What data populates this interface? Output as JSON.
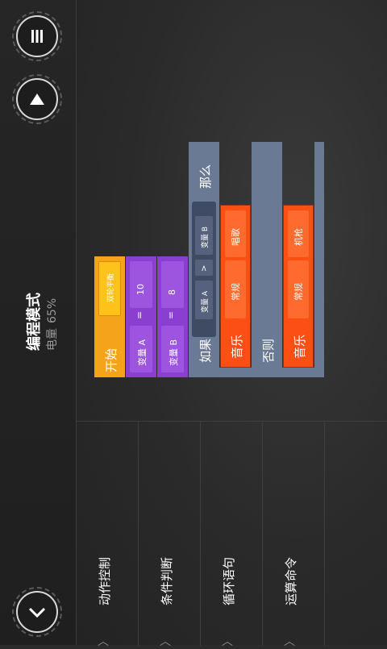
{
  "header": {
    "title": "编程模式",
    "battery_label": "电量",
    "battery_value": "65%"
  },
  "buttons": {
    "menu_icon": "menu-icon",
    "up_icon": "up-arrow-icon",
    "down_icon": "chevron-down-icon"
  },
  "categories": [
    {
      "label": "动作控制"
    },
    {
      "label": "条件判断"
    },
    {
      "label": "循环语句"
    },
    {
      "label": "运算命令"
    }
  ],
  "blocks": {
    "start": {
      "label": "开始",
      "mode": "双轮平衡"
    },
    "var_a": {
      "name": "变量 A",
      "op": "=",
      "value": "10"
    },
    "var_b": {
      "name": "变量 B",
      "op": "=",
      "value": "8"
    },
    "if_block": {
      "keyword": "如果",
      "left": "变量 A",
      "op": ">",
      "right": "变量 B",
      "then": "那么",
      "else": "否则"
    },
    "music_1": {
      "label": "音乐",
      "type": "常规",
      "song": "唱歌"
    },
    "music_2": {
      "label": "音乐",
      "type": "常规",
      "song": "机枪"
    }
  },
  "colors": {
    "orange": "#f5a31a",
    "purple": "#8a3fd0",
    "red": "#fb4f14",
    "gray": "#6b7a94"
  }
}
